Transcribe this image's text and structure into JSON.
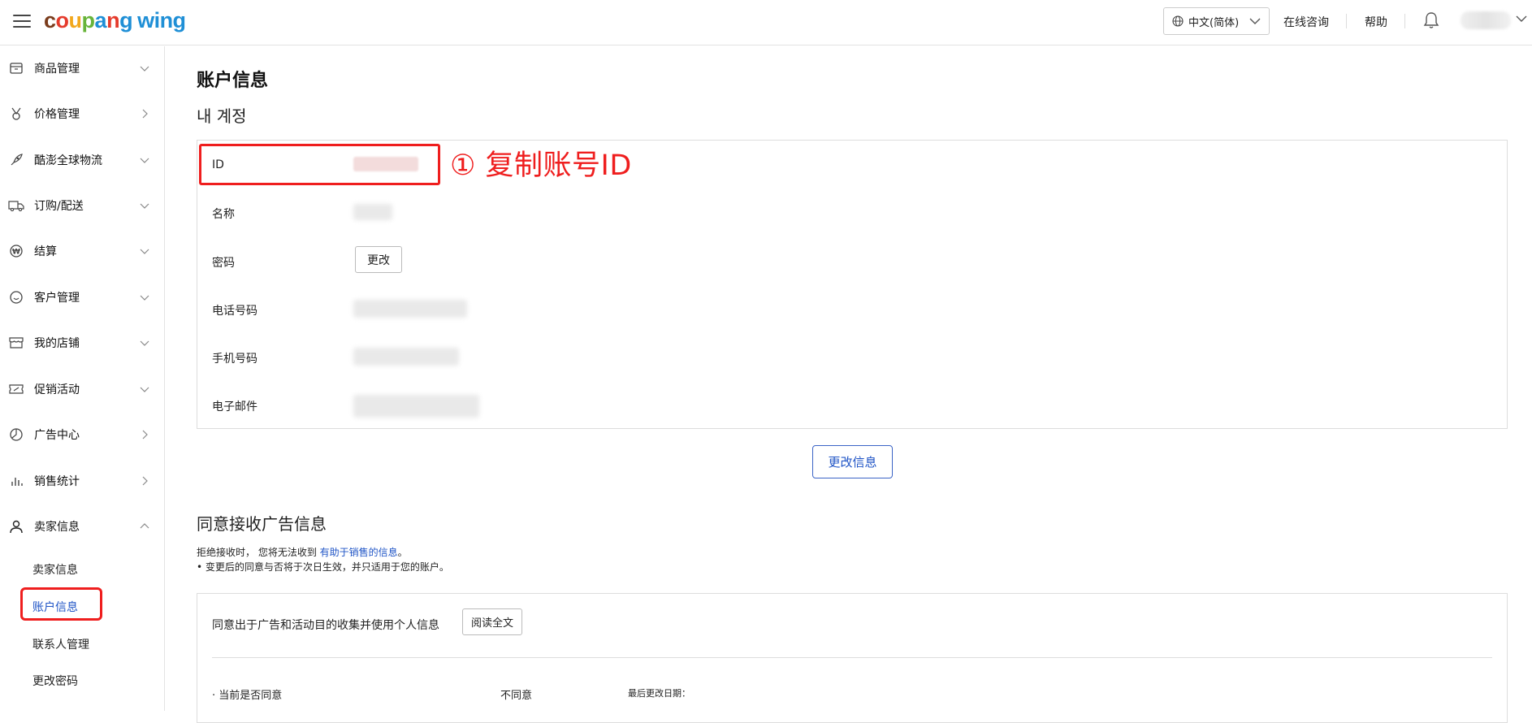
{
  "header": {
    "logo": {
      "letters": [
        "c",
        "o",
        "u",
        "p",
        "a",
        "n",
        "g"
      ],
      "suffix": "wing"
    },
    "language": "中文(简体)",
    "links": [
      "在线咨询",
      "帮助"
    ]
  },
  "sidebar": {
    "items": [
      {
        "label": "商品管理",
        "icon": "box-icon",
        "arrow": "down"
      },
      {
        "label": "价格管理",
        "icon": "medal-icon",
        "arrow": "right"
      },
      {
        "label": "酷澎全球物流",
        "icon": "rocket-icon",
        "arrow": "down"
      },
      {
        "label": "订购/配送",
        "icon": "truck-icon",
        "arrow": "down"
      },
      {
        "label": "结算",
        "icon": "won-icon",
        "arrow": "down"
      },
      {
        "label": "客户管理",
        "icon": "smile-icon",
        "arrow": "down"
      },
      {
        "label": "我的店铺",
        "icon": "store-icon",
        "arrow": "down"
      },
      {
        "label": "促销活动",
        "icon": "ticket-icon",
        "arrow": "down"
      },
      {
        "label": "广告中心",
        "icon": "pie-icon",
        "arrow": "right"
      },
      {
        "label": "销售统计",
        "icon": "bar-chart-icon",
        "arrow": "right"
      },
      {
        "label": "卖家信息",
        "icon": "user-icon",
        "arrow": "up"
      }
    ],
    "sub_items": [
      {
        "label": "卖家信息",
        "active": false
      },
      {
        "label": "账户信息",
        "active": true
      },
      {
        "label": "联系人管理",
        "active": false
      },
      {
        "label": "更改密码",
        "active": false
      }
    ]
  },
  "main": {
    "title": "账户信息",
    "subtitle": "내 계정",
    "rows": [
      {
        "label": "ID"
      },
      {
        "label": "名称"
      },
      {
        "label": "密码",
        "button": "更改"
      },
      {
        "label": "电话号码"
      },
      {
        "label": "手机号码"
      },
      {
        "label": "电子邮件"
      }
    ],
    "annotation": "① 复制账号ID",
    "update_button": "更改信息",
    "ad_section": {
      "title": "同意接收广告信息",
      "note1_prefix": "拒绝接收时， 您将无法收到",
      "note1_link": "有助于销售的信息",
      "note1_suffix": "。",
      "note2": "• 变更后的同意与否将于次日生效，并只适用于您的账户。",
      "consent_text": "同意出于广告和活动目的收集并使用个人信息",
      "read_button": "阅读全文",
      "status_label": "· 当前是否同意",
      "status_value": "不同意",
      "last_changed": "最后更改日期："
    }
  },
  "colors": {
    "accent": "#1f54c6",
    "highlight": "#ef1e1e"
  }
}
